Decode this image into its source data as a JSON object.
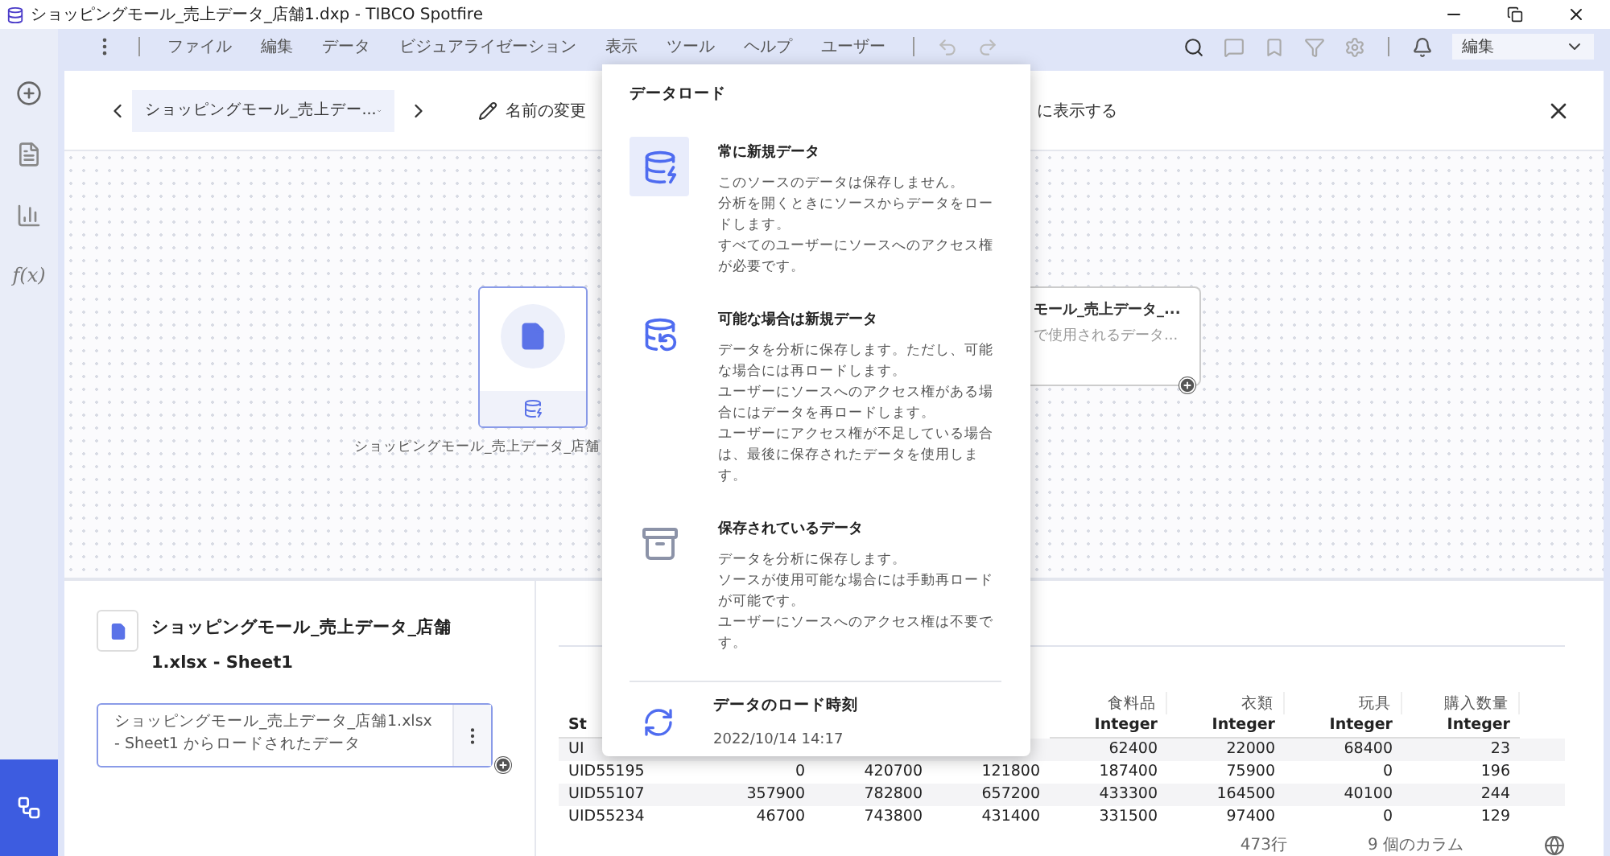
{
  "window": {
    "title": "ショッピングモール_売上データ_店舗1.dxp - TIBCO Spotfire"
  },
  "menu": [
    "ファイル",
    "編集",
    "データ",
    "ビジュアライゼーション",
    "表示",
    "ツール",
    "ヘルプ",
    "ユーザー"
  ],
  "mode_select": {
    "value": "編集"
  },
  "rail": {
    "function_label": "f(x)"
  },
  "header": {
    "source_select": "ショッピングモール_売上デー...",
    "rename": "名前の変更",
    "show_label": "に表示する"
  },
  "canvas": {
    "source_node": {
      "label": "ショッピングモール_売上データ_店舗"
    },
    "table_node": {
      "title": "モール_売上データ_...",
      "subtitle": "で使用されるデータ..."
    }
  },
  "source_panel": {
    "title": "ショッピングモール_売上データ_店舗1.xlsx - Sheet1",
    "step": "ショッピングモール_売上データ_店舗1.xlsx - Sheet1 からロードされたデータ"
  },
  "table": {
    "columns": [
      {
        "type": "St"
      },
      {},
      {},
      {},
      {
        "name": "食料品",
        "type": "Integer"
      },
      {
        "name": "衣類",
        "type": "Integer"
      },
      {
        "name": "玩具",
        "type": "Integer"
      },
      {
        "name": "購入数量",
        "type": "Integer"
      }
    ],
    "rows": [
      [
        "UI",
        null,
        null,
        null,
        "62400",
        "22000",
        "68400",
        "23"
      ],
      [
        "UID55195",
        "0",
        "420700",
        "121800",
        "187400",
        "75900",
        "0",
        "196"
      ],
      [
        "UID55107",
        "357900",
        "782800",
        "657200",
        "433300",
        "164500",
        "40100",
        "244"
      ],
      [
        "UID55234",
        "46700",
        "743800",
        "431400",
        "331500",
        "97400",
        "0",
        "129"
      ]
    ]
  },
  "status": {
    "rows": "473行",
    "columns": "9 個のカラム"
  },
  "popup": {
    "title": "データロード",
    "options": [
      {
        "kind": "always",
        "selected": true,
        "title": "常に新規データ",
        "lines": [
          "このソースのデータは保存しません。",
          "分析を開くときにソースからデータをロードします。",
          "すべてのユーザーにソースへのアクセス権が必要です。"
        ]
      },
      {
        "kind": "when_possible",
        "selected": false,
        "title": "可能な場合は新規データ",
        "lines": [
          "データを分析に保存します。ただし、可能な場合には再ロードします。",
          "ユーザーにソースへのアクセス権がある場合にはデータを再ロードします。",
          "ユーザーにアクセス権が不足している場合は、最後に保存されたデータを使用します。"
        ]
      },
      {
        "kind": "stored",
        "selected": false,
        "title": "保存されているデータ",
        "lines": [
          "データを分析に保存します。",
          "ソースが使用可能な場合には手動再ロードが可能です。",
          "ユーザーにソースへのアクセス権は不要です。"
        ]
      }
    ],
    "load_time": {
      "label": "データのロード時刻",
      "value": "2022/10/14 14:17"
    }
  }
}
